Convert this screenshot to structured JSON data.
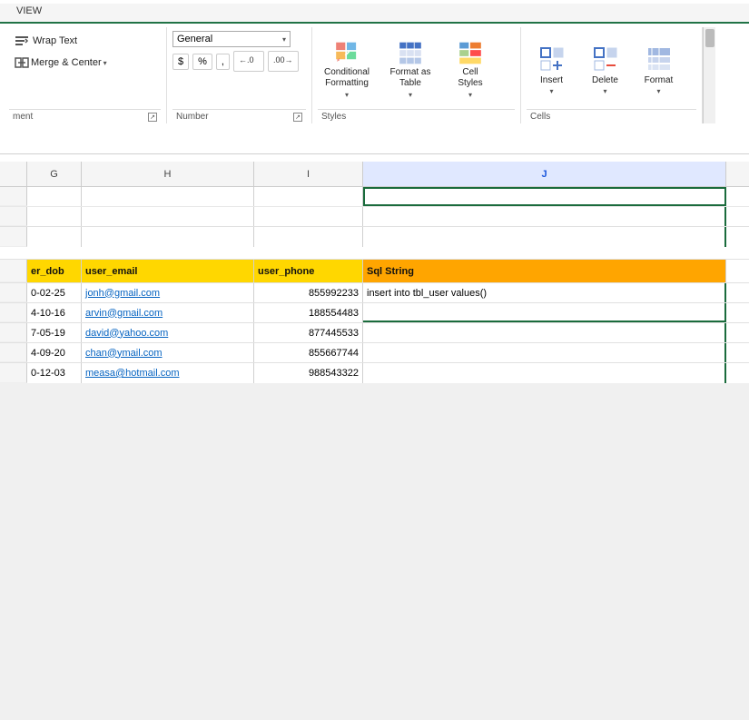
{
  "ribbon": {
    "view_label": "VIEW",
    "wrap_text_label": "Wrap Text",
    "merge_center_label": "Merge & Center",
    "number_format": "General",
    "dollar_label": "$",
    "percent_label": "%",
    "comma_label": ",",
    "dec_left_label": "←.0",
    "dec_right_label": ".00→",
    "conditional_label": "Conditional\nFormatting",
    "format_table_label": "Format as\nTable",
    "cell_styles_label": "Cell\nStyles",
    "insert_label": "Insert",
    "delete_label": "Delete",
    "format_label": "Format",
    "section_alignment_label": "ment",
    "section_number_label": "Number",
    "section_styles_label": "Styles",
    "section_cells_label": "Cells"
  },
  "columns": {
    "headers": [
      "G",
      "H",
      "I",
      "J"
    ],
    "widths": [
      60,
      190,
      120,
      400
    ]
  },
  "table": {
    "headers": [
      "er_dob",
      "user_email",
      "user_phone",
      "Sql String"
    ],
    "rows": [
      [
        "0-02-25",
        "jonh@gmail.com",
        "855992233",
        "insert into tbl_user values()"
      ],
      [
        "4-10-16",
        "arvin@gmail.com",
        "188554483",
        ""
      ],
      [
        "7-05-19",
        "david@yahoo.com",
        "877445533",
        ""
      ],
      [
        "4-09-20",
        "chan@ymail.com",
        "855667744",
        ""
      ],
      [
        "0-12-03",
        "measa@hotmail.com",
        "988543322",
        ""
      ]
    ]
  }
}
